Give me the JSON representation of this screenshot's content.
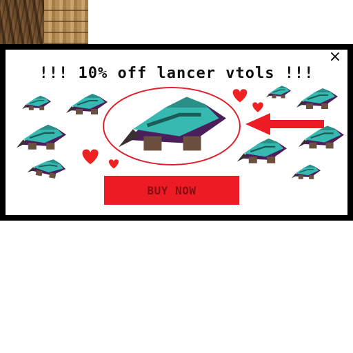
{
  "popup": {
    "headline": "!!! 10% off lancer vtols !!!",
    "buy_label": "BUY NOW",
    "close_glyph": "×"
  },
  "colors": {
    "accent_red": "#ed1c24",
    "ship_teal": "#36b9b0",
    "ship_purple": "#4b1f5c",
    "heart_red": "#ee2222",
    "frame": "#000000"
  },
  "icons": [
    "close-icon",
    "vtol-ship-icon",
    "heart-icon",
    "arrow-left-icon"
  ]
}
